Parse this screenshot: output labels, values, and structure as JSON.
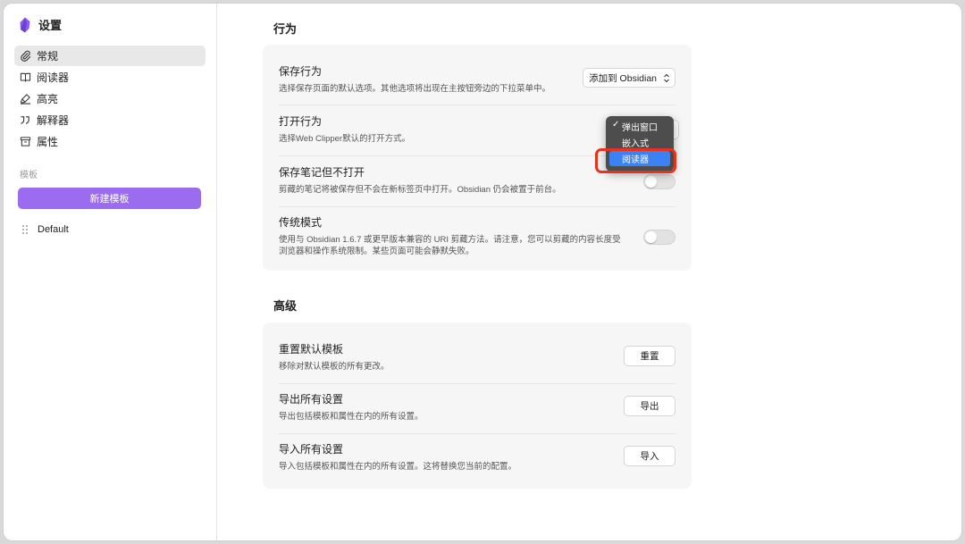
{
  "app": {
    "title": "设置"
  },
  "sidebar": {
    "items": [
      {
        "label": "常规",
        "icon": "paperclip-icon"
      },
      {
        "label": "阅读器",
        "icon": "book-icon"
      },
      {
        "label": "高亮",
        "icon": "highlighter-icon"
      },
      {
        "label": "解释器",
        "icon": "quote-icon"
      },
      {
        "label": "属性",
        "icon": "archive-icon"
      }
    ],
    "templates_label": "模板",
    "new_template_label": "新建模板",
    "templates": [
      {
        "label": "Default"
      }
    ]
  },
  "behavior": {
    "title": "行为",
    "save_behavior": {
      "title": "保存行为",
      "desc": "选择保存页面的默认选项。其他选项将出现在主按钮旁边的下拉菜单中。",
      "value": "添加到 Obsidian"
    },
    "open_behavior": {
      "title": "打开行为",
      "desc": "选择Web Clipper默认的打开方式。",
      "options": [
        "弹出窗口",
        "嵌入式",
        "阅读器"
      ],
      "selected": "弹出窗口",
      "highlighted": "阅读器"
    },
    "save_no_open": {
      "title": "保存笔记但不打开",
      "desc": "剪藏的笔记将被保存但不会在新标签页中打开。Obsidian 仍会被置于前台。",
      "enabled": false
    },
    "legacy_mode": {
      "title": "传统模式",
      "desc_line1": "使用与 Obsidian 1.6.7 或更早版本兼容的 URI 剪藏方法。请注意，您可以剪藏的内容长度受",
      "desc_line2": "浏览器和操作系统限制。某些页面可能会静默失败。",
      "enabled": false
    }
  },
  "advanced": {
    "title": "高级",
    "reset": {
      "title": "重置默认模板",
      "desc": "移除对默认模板的所有更改。",
      "button": "重置"
    },
    "export": {
      "title": "导出所有设置",
      "desc": "导出包括模板和属性在内的所有设置。",
      "button": "导出"
    },
    "import": {
      "title": "导入所有设置",
      "desc": "导入包括模板和属性在内的所有设置。这将替换您当前的配置。",
      "button": "导入"
    }
  },
  "colors": {
    "accent": "#9b6bf0",
    "highlight": "#3b82f6",
    "annotation": "#e8321e"
  }
}
